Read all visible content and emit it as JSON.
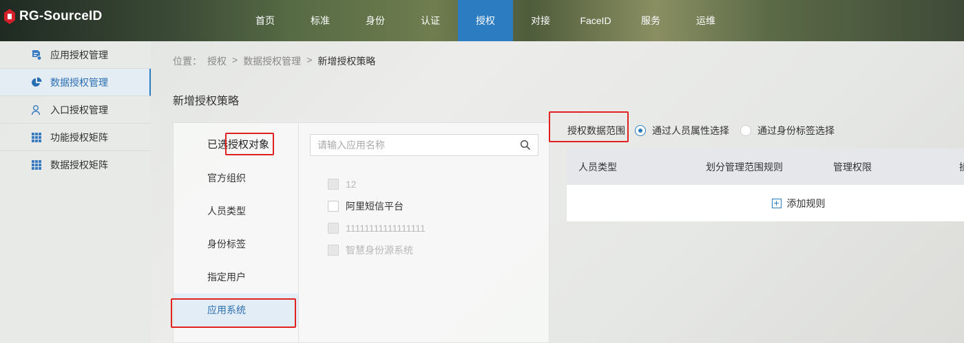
{
  "app": {
    "logo_text": "RG-SourceID"
  },
  "nav": {
    "items": [
      {
        "label": "首页"
      },
      {
        "label": "标准"
      },
      {
        "label": "身份"
      },
      {
        "label": "认证"
      },
      {
        "label": "授权",
        "active": true
      },
      {
        "label": "对接"
      },
      {
        "label": "FaceID"
      },
      {
        "label": "服务"
      },
      {
        "label": "运维"
      }
    ]
  },
  "sidebar": {
    "items": [
      {
        "label": "应用授权管理",
        "icon": "app-doc-icon"
      },
      {
        "label": "数据授权管理",
        "icon": "pie-chart-icon",
        "active": true
      },
      {
        "label": "入口授权管理",
        "icon": "user-outline-icon"
      },
      {
        "label": "功能授权矩阵",
        "icon": "grid-icon"
      },
      {
        "label": "数据授权矩阵",
        "icon": "grid-icon"
      }
    ]
  },
  "breadcrumb": {
    "prefix": "位置：",
    "items": [
      "授权",
      "数据授权管理",
      "新增授权策略"
    ],
    "separator": ">"
  },
  "page": {
    "title": "新增授权策略"
  },
  "objects": {
    "header": "已选授权对象",
    "categories": [
      "官方组织",
      "人员类型",
      "身份标签",
      "指定用户",
      "应用系统"
    ],
    "active_category": "应用系统"
  },
  "app_select": {
    "search_placeholder": "请输入应用名称",
    "apps": [
      {
        "name": "12",
        "disabled": true
      },
      {
        "name": "阿里短信平台",
        "disabled": false
      },
      {
        "name": "11111111111111111",
        "disabled": true
      },
      {
        "name": "智慧身份源系统",
        "disabled": true
      }
    ]
  },
  "scope": {
    "label": "授权数据范围",
    "options": [
      {
        "label": "通过人员属性选择",
        "checked": true
      },
      {
        "label": "通过身份标签选择",
        "checked": false
      }
    ]
  },
  "rules_table": {
    "columns": [
      "人员类型",
      "划分管理范围规则",
      "管理权限",
      "操"
    ],
    "add_label": "添加规则"
  },
  "colors": {
    "accent": "#2b7cc0",
    "highlight": "#e0201e"
  }
}
